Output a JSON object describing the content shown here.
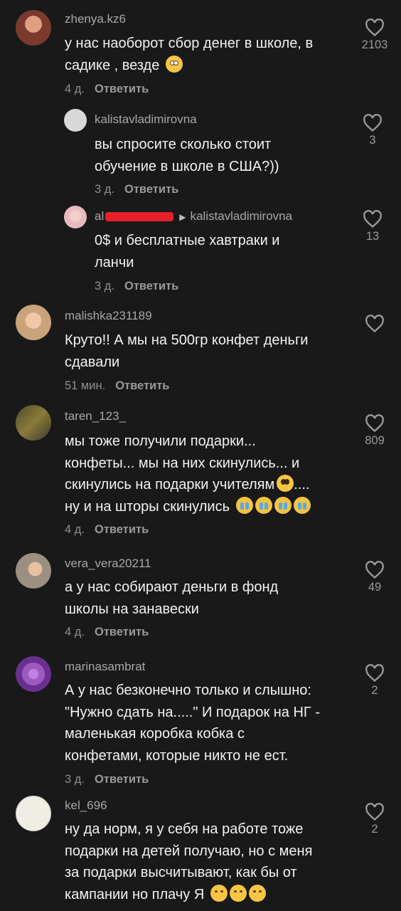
{
  "comments": [
    {
      "username": "zhenya.kz6",
      "lines": [
        "у нас наоборот сбор денег в школе, в",
        "садике , везде"
      ],
      "emoji": "flushed",
      "time": "4 д.",
      "reply": "Ответить",
      "likes": "2103",
      "avatar_color": "#7a3a2e"
    },
    {
      "username": "kalistavladimirovna",
      "lines": [
        "вы спросите сколько стоит",
        "обучение в школе в США?))"
      ],
      "time": "3 д.",
      "reply": "Ответить",
      "likes": "3",
      "avatar_color": "#d8d8d8"
    },
    {
      "username_prefix": "al",
      "reply_to": "kalistavladimirovna",
      "lines": [
        "0$ и бесплатные хавтраки и",
        "ланчи"
      ],
      "time": "3 д.",
      "reply": "Ответить",
      "likes": "13",
      "avatar_color": "#e8b8c0"
    },
    {
      "username": "malishka231189",
      "lines": [
        "Круто!! А мы на 500гр конфет деньги",
        "сдавали"
      ],
      "time": "51 мин.",
      "reply": "Ответить",
      "likes": "",
      "avatar_color": "#c9a37a"
    },
    {
      "username": "taren_123_",
      "lines": [
        "мы тоже получили подарки...",
        "конфеты... мы на них скинулись... и",
        "скинулись на подарки учителям",
        "ну и на шторы скинулись"
      ],
      "time": "4 д.",
      "reply": "Ответить",
      "likes": "809",
      "avatar_color": "#6e6a3c"
    },
    {
      "username": "vera_vera20211",
      "lines": [
        "а у нас собирают деньги в фонд",
        "школы на занавески"
      ],
      "time": "4 д.",
      "reply": "Ответить",
      "likes": "49",
      "avatar_color": "#9a8f80"
    },
    {
      "username": "marinasambrat",
      "lines": [
        "А у нас безконечно только и слышно:",
        "\"Нужно сдать на.....\" И подарок на НГ -",
        "маленькая коробка кобка с",
        "конфетами, которые никто не ест."
      ],
      "time": "3 д.",
      "reply": "Ответить",
      "likes": "2",
      "avatar_color": "#9c5ac0"
    },
    {
      "username": "kel_696",
      "lines": [
        "ну да норм, я у себя на работе тоже",
        "подарки на детей получаю, но с меня",
        "за подарки высчитывают, как бы от",
        "кампании но плачу Я"
      ],
      "time": "",
      "reply": "",
      "likes": "2",
      "avatar_color": "#f0ede4"
    }
  ],
  "icons": {
    "like": "heart-outline-icon",
    "reply_arrow": "triangle-right-icon"
  },
  "colors": {
    "background": "#191919",
    "redaction": "#e5202a"
  }
}
